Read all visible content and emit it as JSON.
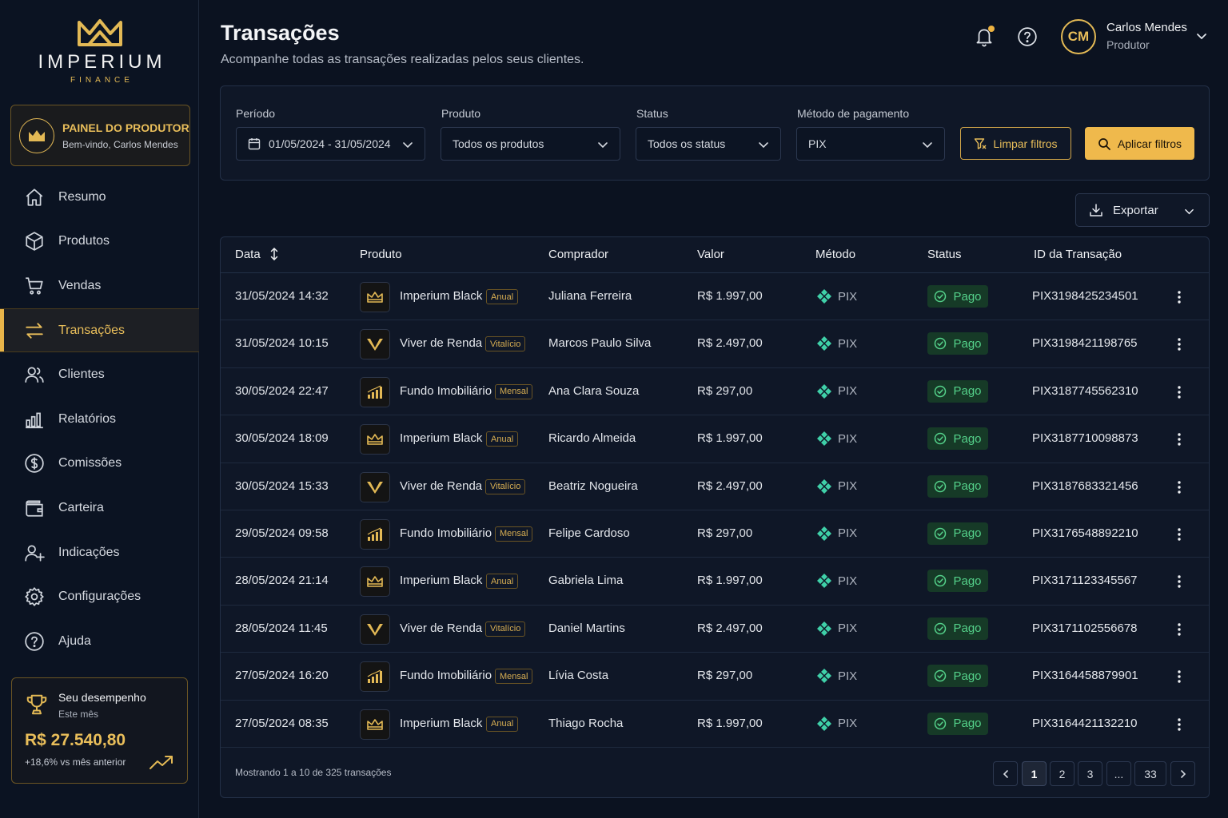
{
  "brand": {
    "name": "IMPERIUM",
    "sub": "FINANCE",
    "gold": "#e9be5a"
  },
  "panel": {
    "title": "PAINEL DO PRODUTOR",
    "welcome": "Bem-vindo, Carlos Mendes"
  },
  "nav": [
    {
      "label": "Resumo",
      "icon": "home-icon"
    },
    {
      "label": "Produtos",
      "icon": "box-icon"
    },
    {
      "label": "Vendas",
      "icon": "cart-icon"
    },
    {
      "label": "Transações",
      "icon": "transfer-icon",
      "active": true
    },
    {
      "label": "Clientes",
      "icon": "users-icon"
    },
    {
      "label": "Relatórios",
      "icon": "bar-chart-icon"
    },
    {
      "label": "Comissões",
      "icon": "dollar-circle-icon"
    },
    {
      "label": "Carteira",
      "icon": "wallet-icon"
    },
    {
      "label": "Indicações",
      "icon": "user-plus-icon"
    },
    {
      "label": "Configurações",
      "icon": "gear-icon"
    },
    {
      "label": "Ajuda",
      "icon": "help-icon"
    }
  ],
  "performance": {
    "title": "Seu desempenho",
    "period": "Este mês",
    "value": "R$ 27.540,80",
    "delta": "+18,6% vs mês anterior"
  },
  "header": {
    "title": "Transações",
    "subtitle": "Acompanhe todas as transações realizadas pelos seus clientes.",
    "user_initials": "CM",
    "user_name": "Carlos Mendes",
    "user_role": "Produtor"
  },
  "filters": {
    "period_label": "Período",
    "period_value": "01/05/2024 - 31/05/2024",
    "product_label": "Produto",
    "product_value": "Todos os produtos",
    "status_label": "Status",
    "status_value": "Todos os status",
    "method_label": "Método de pagamento",
    "method_value": "PIX",
    "clear_label": "Limpar filtros",
    "apply_label": "Aplicar filtros"
  },
  "export_label": "Exportar",
  "table": {
    "columns": [
      "Data",
      "Produto",
      "Comprador",
      "Valor",
      "Método",
      "Status",
      "ID da Transação"
    ],
    "rows": [
      {
        "date": "31/05/2024 14:32",
        "product": "Imperium Black",
        "plan": "Anual",
        "icon": "crown",
        "buyer": "Juliana Ferreira",
        "value": "R$ 1.997,00",
        "method": "PIX",
        "status": "Pago",
        "id": "PIX3198425234501"
      },
      {
        "date": "31/05/2024 10:15",
        "product": "Viver de Renda",
        "plan": "Vitalício",
        "icon": "v",
        "buyer": "Marcos Paulo Silva",
        "value": "R$ 2.497,00",
        "method": "PIX",
        "status": "Pago",
        "id": "PIX3198421198765"
      },
      {
        "date": "30/05/2024 22:47",
        "product": "Fundo Imobiliário",
        "plan": "Mensal",
        "icon": "bars",
        "buyer": "Ana Clara Souza",
        "value": "R$ 297,00",
        "method": "PIX",
        "status": "Pago",
        "id": "PIX3187745562310"
      },
      {
        "date": "30/05/2024 18:09",
        "product": "Imperium Black",
        "plan": "Anual",
        "icon": "crown",
        "buyer": "Ricardo Almeida",
        "value": "R$ 1.997,00",
        "method": "PIX",
        "status": "Pago",
        "id": "PIX3187710098873"
      },
      {
        "date": "30/05/2024 15:33",
        "product": "Viver de Renda",
        "plan": "Vitalício",
        "icon": "v",
        "buyer": "Beatriz Nogueira",
        "value": "R$ 2.497,00",
        "method": "PIX",
        "status": "Pago",
        "id": "PIX3187683321456"
      },
      {
        "date": "29/05/2024 09:58",
        "product": "Fundo Imobiliário",
        "plan": "Mensal",
        "icon": "bars",
        "buyer": "Felipe Cardoso",
        "value": "R$ 297,00",
        "method": "PIX",
        "status": "Pago",
        "id": "PIX3176548892210"
      },
      {
        "date": "28/05/2024 21:14",
        "product": "Imperium Black",
        "plan": "Anual",
        "icon": "crown",
        "buyer": "Gabriela Lima",
        "value": "R$ 1.997,00",
        "method": "PIX",
        "status": "Pago",
        "id": "PIX3171123345567"
      },
      {
        "date": "28/05/2024 11:45",
        "product": "Viver de Renda",
        "plan": "Vitalício",
        "icon": "v",
        "buyer": "Daniel Martins",
        "value": "R$ 2.497,00",
        "method": "PIX",
        "status": "Pago",
        "id": "PIX3171102556678"
      },
      {
        "date": "27/05/2024 16:20",
        "product": "Fundo Imobiliário",
        "plan": "Mensal",
        "icon": "bars",
        "buyer": "Lívia Costa",
        "value": "R$ 297,00",
        "method": "PIX",
        "status": "Pago",
        "id": "PIX3164458879901"
      },
      {
        "date": "27/05/2024 08:35",
        "product": "Imperium Black",
        "plan": "Anual",
        "icon": "crown",
        "buyer": "Thiago Rocha",
        "value": "R$ 1.997,00",
        "method": "PIX",
        "status": "Pago",
        "id": "PIX3164421132210"
      }
    ]
  },
  "footer": {
    "showing": "Mostrando 1 a 10 de 325 transações",
    "pages": [
      "1",
      "2",
      "3",
      "...",
      "33"
    ]
  }
}
